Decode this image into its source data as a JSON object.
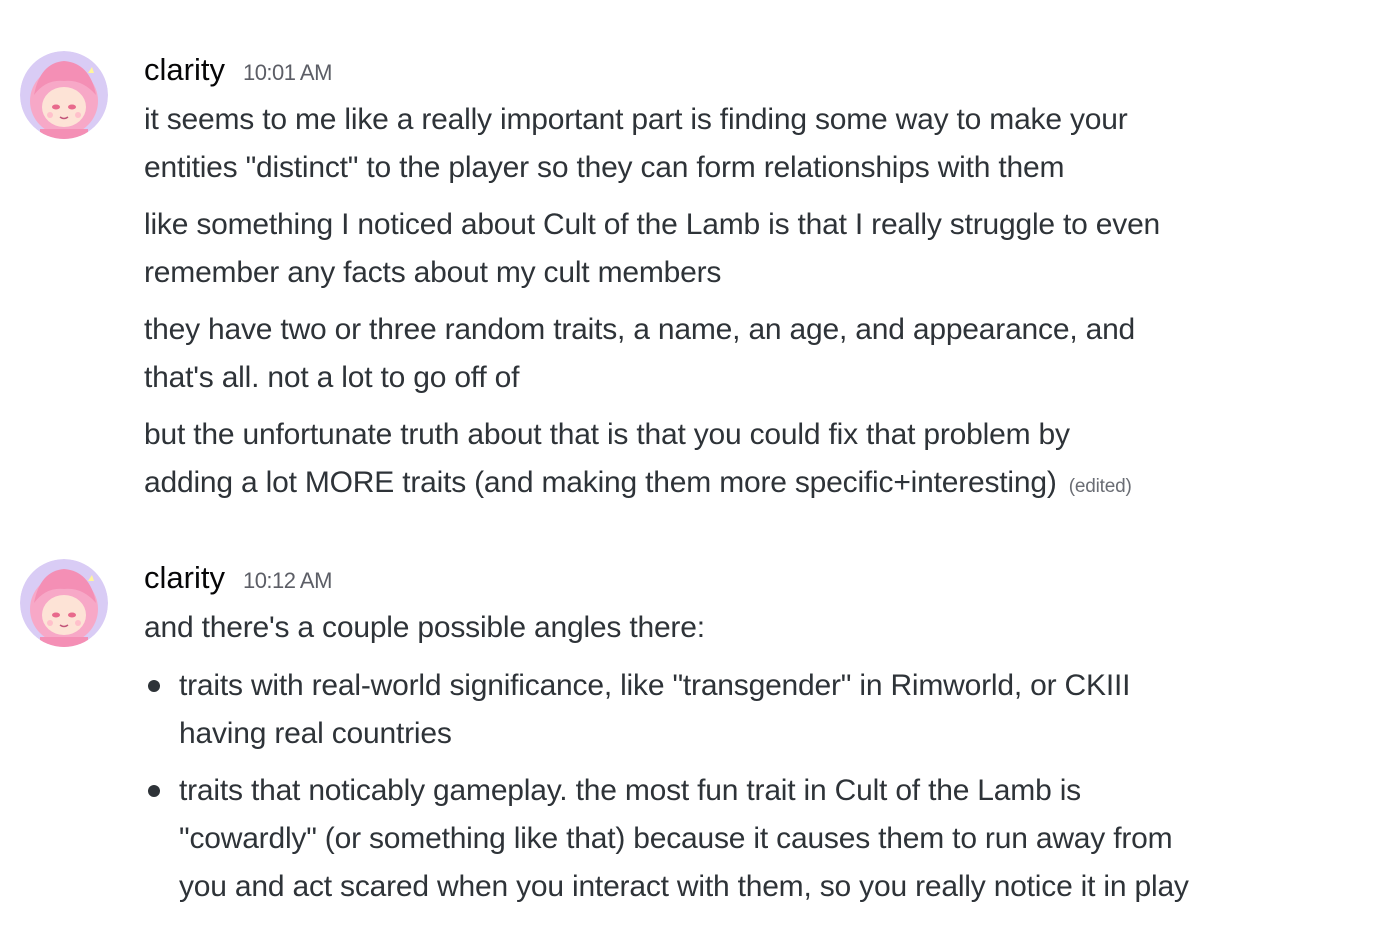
{
  "colors": {
    "background": "#ffffff",
    "username": "#060607",
    "text": "#2e3338",
    "timestamp": "#5c5e66",
    "avatar_hair": "#f4a3c4",
    "avatar_bg": "#c7b8f0"
  },
  "messages": [
    {
      "author": "clarity",
      "avatar_icon": "user-avatar-icon",
      "timestamp": "10:01 AM",
      "lines": [
        "it seems to me like a really important part is finding some way to make your",
        "entities \"distinct\" to the player so they can form relationships with them",
        "like something I noticed about Cult of the Lamb is that I really struggle to even",
        "remember any facts about my cult members",
        "they have two or three random traits, a name, an age, and appearance, and",
        "that's all. not a lot to go off of",
        "but the unfortunate truth about that is that you could fix that problem by",
        "adding a lot MORE traits (and making them more specific+interesting)"
      ],
      "edited_label": "(edited)"
    },
    {
      "author": "clarity",
      "avatar_icon": "user-avatar-icon",
      "timestamp": "10:12 AM",
      "intro": "and there's a couple possible angles there:",
      "bullets": [
        {
          "lines": [
            "traits with real-world significance, like \"transgender\" in Rimworld, or CKIII",
            "having real countries"
          ]
        },
        {
          "lines": [
            "traits that noticably gameplay. the most fun trait in Cult of the Lamb is",
            "\"cowardly\" (or something like that) because it causes them to run away from",
            "you and act scared when you interact with them, so you really notice it in play"
          ]
        }
      ]
    }
  ]
}
